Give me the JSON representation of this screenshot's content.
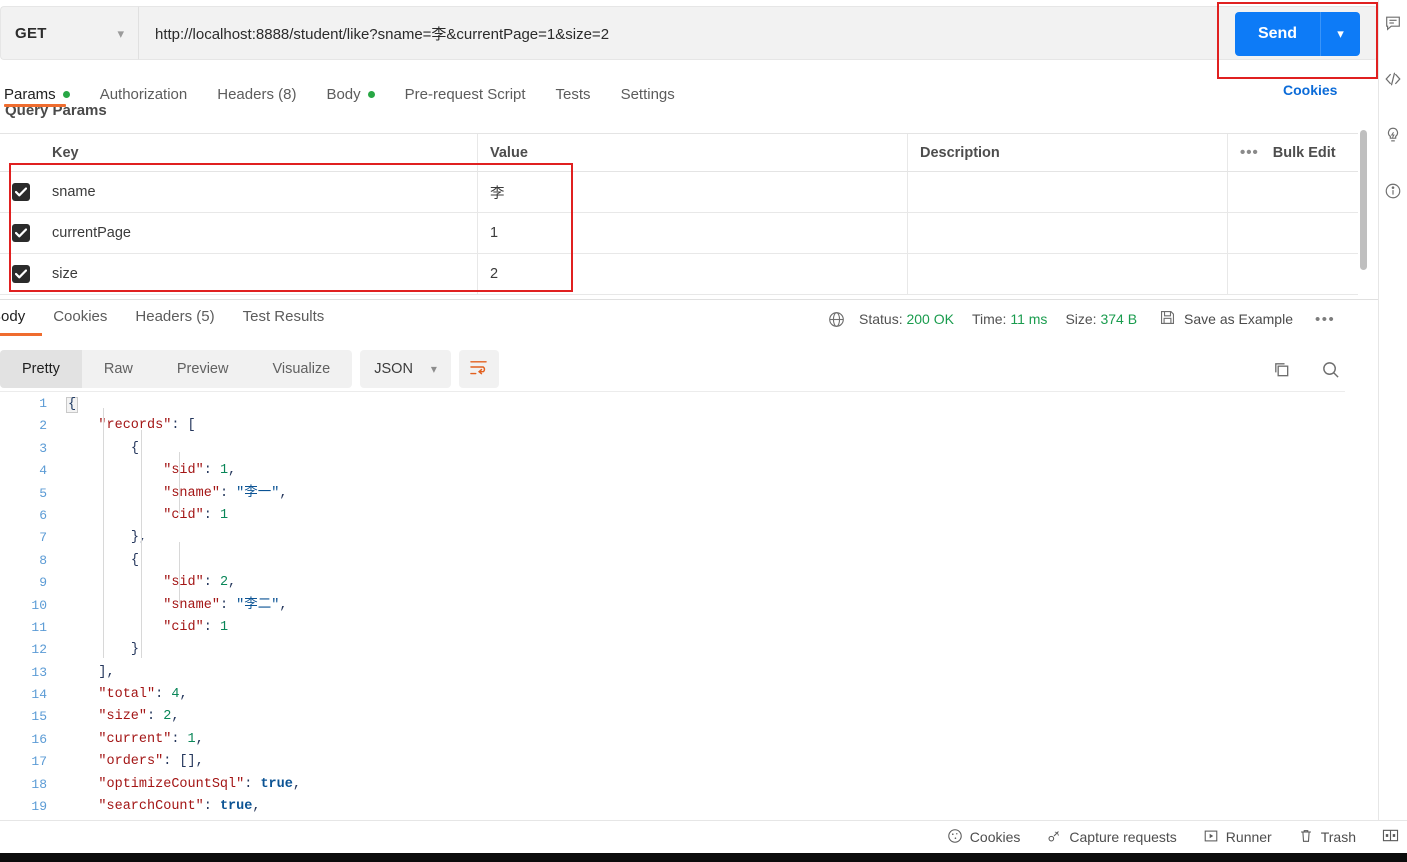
{
  "request": {
    "method": "GET",
    "url": "http://localhost:8888/student/like?sname=李&currentPage=1&size=2",
    "send_label": "Send",
    "cookies_label": "Cookies",
    "tabs": [
      {
        "label": "Params",
        "dot": true,
        "active": true
      },
      {
        "label": "Authorization",
        "dot": false,
        "active": false
      },
      {
        "label": "Headers (8)",
        "dot": false,
        "active": false
      },
      {
        "label": "Body",
        "dot": true,
        "active": false
      },
      {
        "label": "Pre-request Script",
        "dot": false,
        "active": false
      },
      {
        "label": "Tests",
        "dot": false,
        "active": false
      },
      {
        "label": "Settings",
        "dot": false,
        "active": false
      }
    ],
    "section_title": "Query Params",
    "table": {
      "headers": [
        "Key",
        "Value",
        "Description"
      ],
      "bulk_edit_label": "Bulk Edit",
      "rows": [
        {
          "checked": true,
          "key": "sname",
          "value": "李",
          "description": ""
        },
        {
          "checked": true,
          "key": "currentPage",
          "value": "1",
          "description": ""
        },
        {
          "checked": true,
          "key": "size",
          "value": "2",
          "description": ""
        }
      ]
    }
  },
  "response": {
    "tabs": [
      {
        "label": "Body",
        "active": true
      },
      {
        "label": "Cookies",
        "active": false
      },
      {
        "label": "Headers (5)",
        "active": false
      },
      {
        "label": "Test Results",
        "active": false
      }
    ],
    "status_label": "Status:",
    "status_value": "200 OK",
    "time_label": "Time:",
    "time_value": "11 ms",
    "size_label": "Size:",
    "size_value": "374 B",
    "save_example_label": "Save as Example",
    "view_modes": [
      {
        "label": "Pretty",
        "active": true
      },
      {
        "label": "Raw",
        "active": false
      },
      {
        "label": "Preview",
        "active": false
      },
      {
        "label": "Visualize",
        "active": false
      }
    ],
    "format": "JSON",
    "body_lines": [
      {
        "n": 1,
        "html": "<span class=\"fold\">{</span>"
      },
      {
        "n": 2,
        "html": "    <span class=\"k\">\"records\"</span><span class=\"p\">: [</span>"
      },
      {
        "n": 3,
        "html": "        <span class=\"p\">{</span>"
      },
      {
        "n": 4,
        "html": "            <span class=\"k\">\"sid\"</span><span class=\"p\">: </span><span class=\"n\">1</span><span class=\"p\">,</span>"
      },
      {
        "n": 5,
        "html": "            <span class=\"k\">\"sname\"</span><span class=\"p\">: </span><span class=\"s\">\"李一\"</span><span class=\"p\">,</span>"
      },
      {
        "n": 6,
        "html": "            <span class=\"k\">\"cid\"</span><span class=\"p\">: </span><span class=\"n\">1</span>"
      },
      {
        "n": 7,
        "html": "        <span class=\"p\">},</span>"
      },
      {
        "n": 8,
        "html": "        <span class=\"p\">{</span>"
      },
      {
        "n": 9,
        "html": "            <span class=\"k\">\"sid\"</span><span class=\"p\">: </span><span class=\"n\">2</span><span class=\"p\">,</span>"
      },
      {
        "n": 10,
        "html": "            <span class=\"k\">\"sname\"</span><span class=\"p\">: </span><span class=\"s\">\"李二\"</span><span class=\"p\">,</span>"
      },
      {
        "n": 11,
        "html": "            <span class=\"k\">\"cid\"</span><span class=\"p\">: </span><span class=\"n\">1</span>"
      },
      {
        "n": 12,
        "html": "        <span class=\"p\">}</span>"
      },
      {
        "n": 13,
        "html": "    <span class=\"p\">],</span>"
      },
      {
        "n": 14,
        "html": "    <span class=\"k\">\"total\"</span><span class=\"p\">: </span><span class=\"n\">4</span><span class=\"p\">,</span>"
      },
      {
        "n": 15,
        "html": "    <span class=\"k\">\"size\"</span><span class=\"p\">: </span><span class=\"n\">2</span><span class=\"p\">,</span>"
      },
      {
        "n": 16,
        "html": "    <span class=\"k\">\"current\"</span><span class=\"p\">: </span><span class=\"n\">1</span><span class=\"p\">,</span>"
      },
      {
        "n": 17,
        "html": "    <span class=\"k\">\"orders\"</span><span class=\"p\">: </span><span class=\"p\">[],</span>"
      },
      {
        "n": 18,
        "html": "    <span class=\"k\">\"optimizeCountSql\"</span><span class=\"p\">: </span><span class=\"b\">true</span><span class=\"p\">,</span>"
      },
      {
        "n": 19,
        "html": "    <span class=\"k\">\"searchCount\"</span><span class=\"p\">: </span><span class=\"b\">true</span><span class=\"p\">,</span>"
      }
    ],
    "json_payload": {
      "records": [
        {
          "sid": 1,
          "sname": "李一",
          "cid": 1
        },
        {
          "sid": 2,
          "sname": "李二",
          "cid": 1
        }
      ],
      "total": 4,
      "size": 2,
      "current": 1,
      "orders": [],
      "optimizeCountSql": true,
      "searchCount": true
    }
  },
  "footer": {
    "items": [
      {
        "label": "Cookies",
        "icon": "cookie-icon"
      },
      {
        "label": "Capture requests",
        "icon": "satellite-icon"
      },
      {
        "label": "Runner",
        "icon": "play-icon"
      },
      {
        "label": "Trash",
        "icon": "trash-icon"
      }
    ]
  },
  "colors": {
    "accent_blue": "#0d7bf7",
    "highlight_red": "#e02020",
    "tab_orange": "#ef6c2e",
    "status_green": "#1a9c4e"
  }
}
